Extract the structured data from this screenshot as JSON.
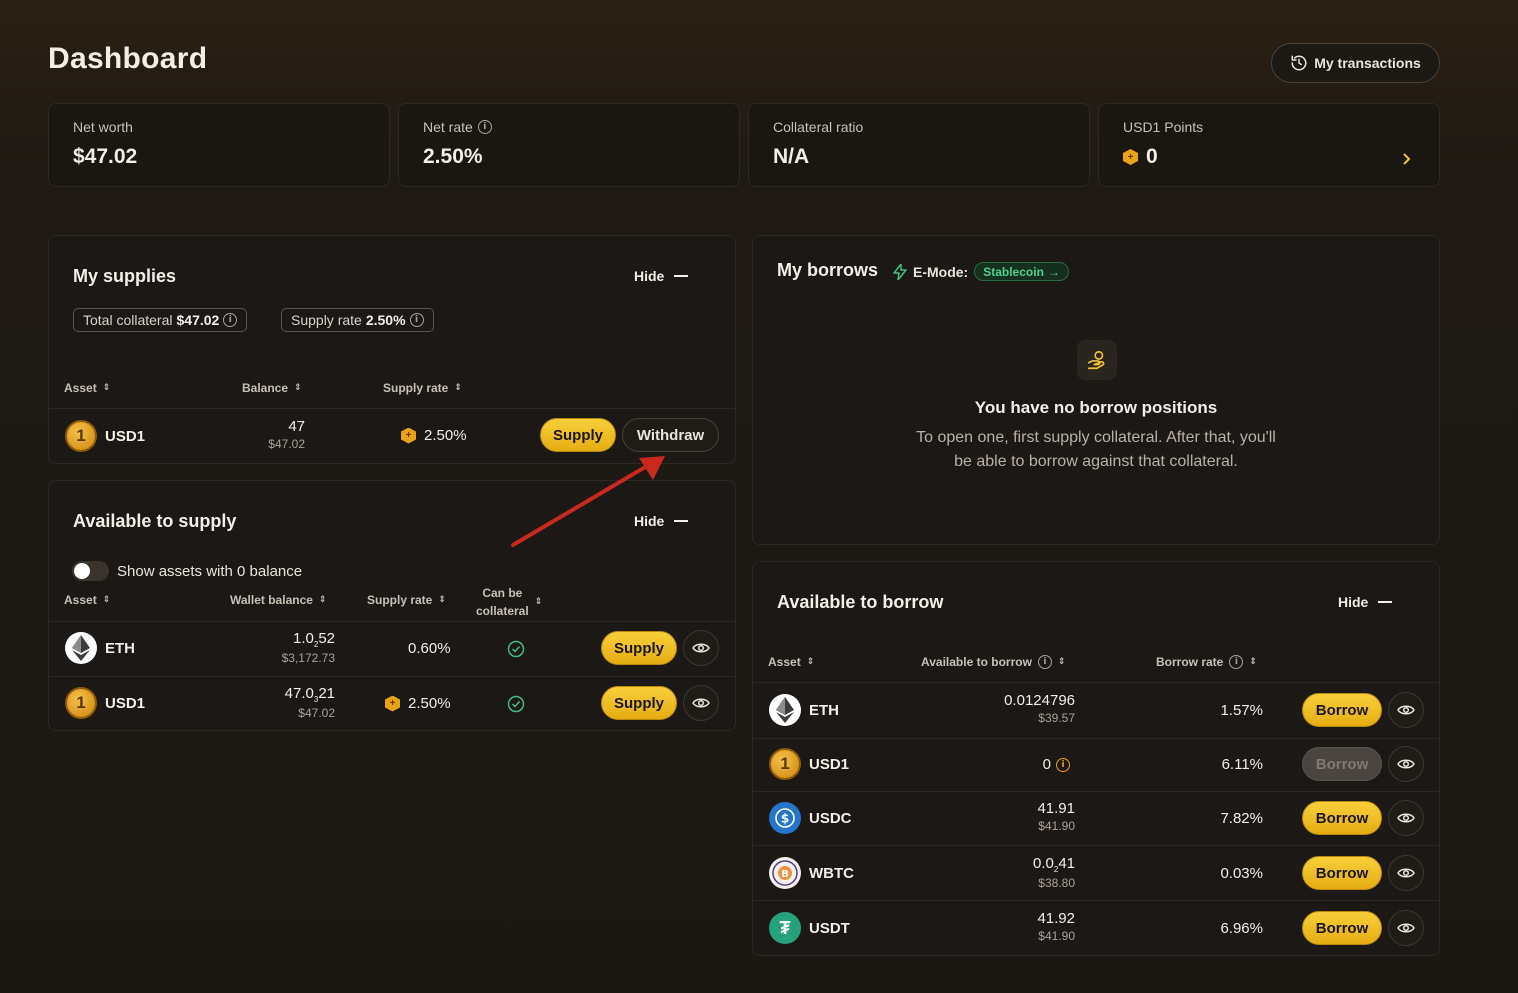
{
  "header": {
    "title": "Dashboard",
    "transactions_label": "My transactions"
  },
  "stats": [
    {
      "label": "Net worth",
      "value": "$47.02"
    },
    {
      "label": "Net rate",
      "value": "2.50%"
    },
    {
      "label": "Collateral ratio",
      "value": "N/A"
    },
    {
      "label": "USD1 Points",
      "value": "0"
    }
  ],
  "supplies": {
    "title": "My supplies",
    "hide_label": "Hide",
    "total_collateral_label": "Total collateral",
    "total_collateral_value": "$47.02",
    "supply_rate_label": "Supply rate",
    "supply_rate_value": "2.50%",
    "headers": {
      "asset": "Asset",
      "balance": "Balance",
      "supply_rate": "Supply rate"
    },
    "rows": [
      {
        "asset": "USD1",
        "balance": "47",
        "balance_usd": "$47.02",
        "rate": "2.50%",
        "supply_label": "Supply",
        "withdraw_label": "Withdraw"
      }
    ]
  },
  "available_supply": {
    "title": "Available to supply",
    "hide_label": "Hide",
    "toggle_label": "Show assets with 0 balance",
    "headers": {
      "asset": "Asset",
      "wallet_balance": "Wallet balance",
      "supply_rate": "Supply rate",
      "can_be_collateral_1": "Can be",
      "can_be_collateral_2": "collateral"
    },
    "rows": [
      {
        "asset": "ETH",
        "balance_main": "1.0",
        "balance_sub": "2",
        "balance_tail": "52",
        "balance_usd": "$3,172.73",
        "rate": "0.60%",
        "supply_label": "Supply"
      },
      {
        "asset": "USD1",
        "balance_main": "47.0",
        "balance_sub": "3",
        "balance_tail": "21",
        "balance_usd": "$47.02",
        "rate": "2.50%",
        "supply_label": "Supply"
      }
    ]
  },
  "borrows": {
    "title": "My borrows",
    "emode_label": "E-Mode:",
    "emode_value": "Stablecoin",
    "empty_title": "You have no borrow positions",
    "empty_line1": "To open one, first supply collateral. After that, you'll",
    "empty_line2": "be able to borrow against that collateral."
  },
  "available_borrow": {
    "title": "Available to borrow",
    "hide_label": "Hide",
    "headers": {
      "asset": "Asset",
      "available": "Available to borrow",
      "borrow_rate": "Borrow rate"
    },
    "borrow_label": "Borrow",
    "rows": [
      {
        "asset": "ETH",
        "available": "0.0124796",
        "available_usd": "$39.57",
        "rate": "1.57%"
      },
      {
        "asset": "USD1",
        "available": "0",
        "available_usd": "",
        "rate": "6.11%"
      },
      {
        "asset": "USDC",
        "available": "41.91",
        "available_usd": "$41.90",
        "rate": "7.82%"
      },
      {
        "asset": "WBTC",
        "available_main": "0.0",
        "available_sub": "2",
        "available_tail": "41",
        "available_usd": "$38.80",
        "rate": "0.03%"
      },
      {
        "asset": "USDT",
        "available": "41.92",
        "available_usd": "$41.90",
        "rate": "6.96%"
      }
    ]
  }
}
